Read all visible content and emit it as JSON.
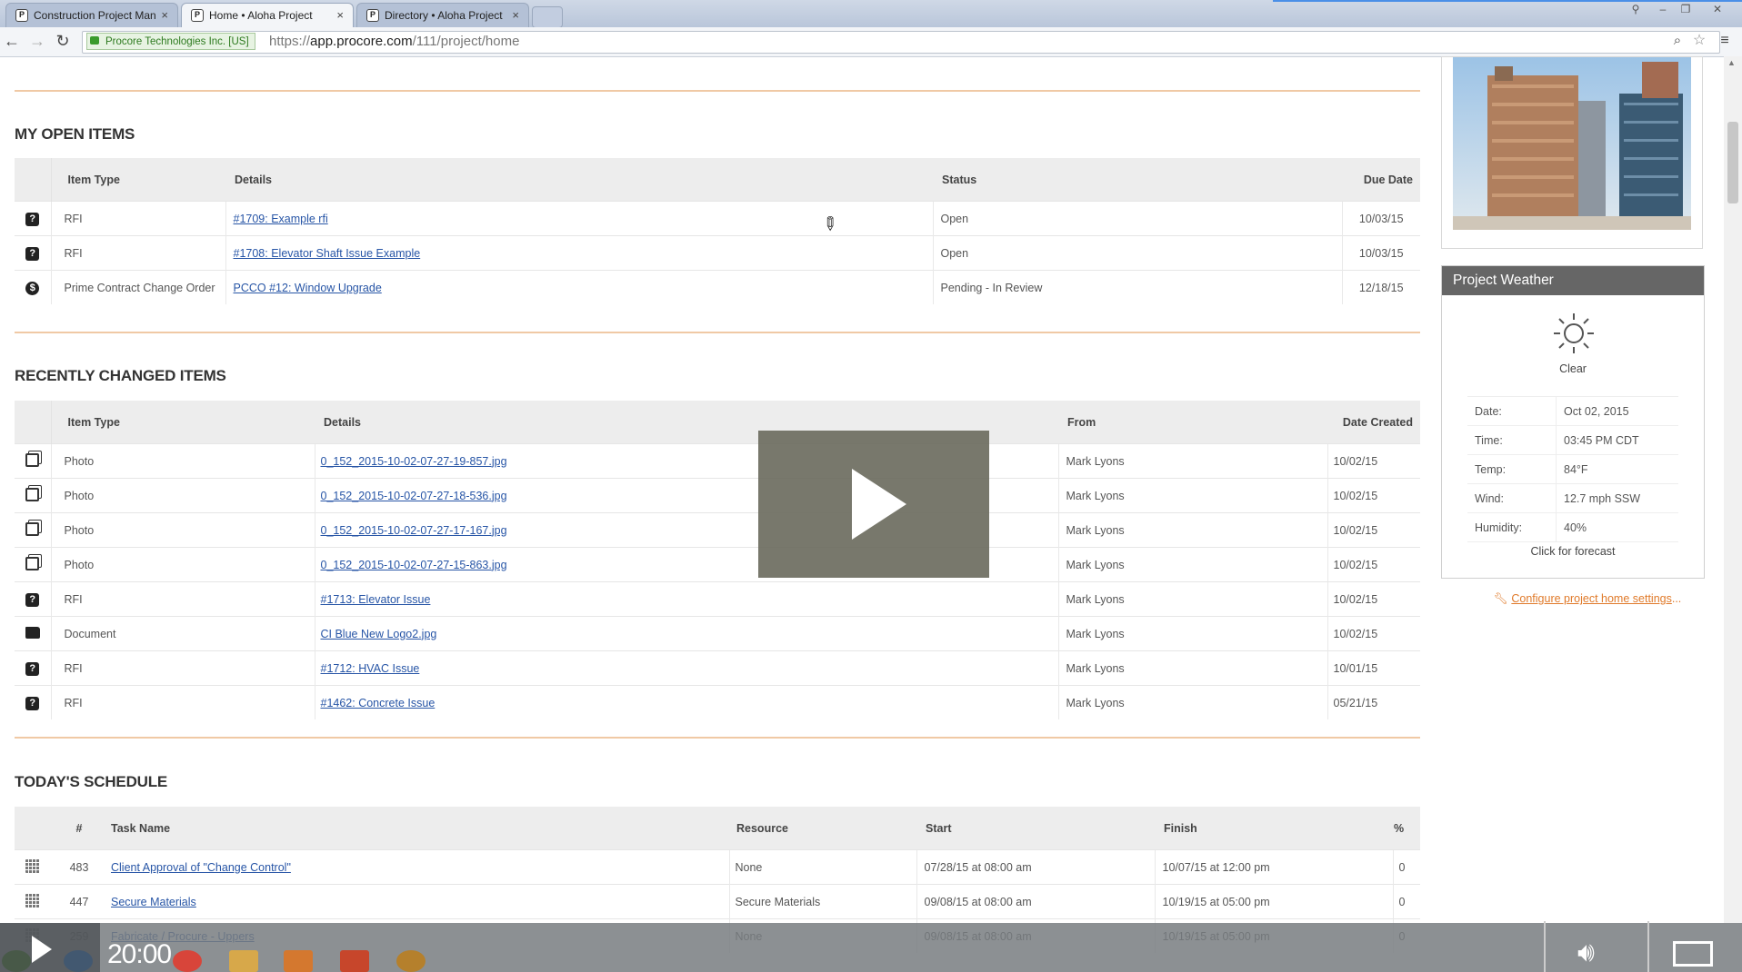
{
  "browser": {
    "tabs": [
      {
        "label": "Construction Project Man"
      },
      {
        "label": "Home • Aloha Project"
      },
      {
        "label": "Directory • Aloha Project"
      }
    ],
    "ssl_label": "Procore Technologies Inc. [US]",
    "url_prefix": "https://",
    "url_host": "app.procore.com",
    "url_path": "/111/project/home"
  },
  "open_items": {
    "title": "MY OPEN ITEMS",
    "headers": [
      "Item Type",
      "Details",
      "Status",
      "Due Date"
    ],
    "rows": [
      {
        "icon": "rfi-icon",
        "type": "RFI",
        "details": "#1709: Example rfi",
        "status": "Open",
        "due": "10/03/15"
      },
      {
        "icon": "rfi-icon",
        "type": "RFI",
        "details": "#1708: Elevator Shaft Issue Example",
        "status": "Open",
        "due": "10/03/15"
      },
      {
        "icon": "change-order-icon",
        "type": "Prime Contract Change Order",
        "details": "PCCO #12: Window Upgrade",
        "status": "Pending - In Review",
        "due": "12/18/15"
      }
    ]
  },
  "recent_items": {
    "title": "RECENTLY CHANGED ITEMS",
    "headers": [
      "Item Type",
      "Details",
      "From",
      "Date Created"
    ],
    "rows": [
      {
        "icon": "photo-icon",
        "type": "Photo",
        "details": "0_152_2015-10-02-07-27-19-857.jpg",
        "from": "Mark Lyons",
        "date": "10/02/15"
      },
      {
        "icon": "photo-icon",
        "type": "Photo",
        "details": "0_152_2015-10-02-07-27-18-536.jpg",
        "from": "Mark Lyons",
        "date": "10/02/15"
      },
      {
        "icon": "photo-icon",
        "type": "Photo",
        "details": "0_152_2015-10-02-07-27-17-167.jpg",
        "from": "Mark Lyons",
        "date": "10/02/15"
      },
      {
        "icon": "photo-icon",
        "type": "Photo",
        "details": "0_152_2015-10-02-07-27-15-863.jpg",
        "from": "Mark Lyons",
        "date": "10/02/15"
      },
      {
        "icon": "rfi-icon",
        "type": "RFI",
        "details": "#1713: Elevator Issue",
        "from": "Mark Lyons",
        "date": "10/02/15"
      },
      {
        "icon": "folder-icon",
        "type": "Document",
        "details": "CI Blue New Logo2.jpg",
        "from": "Mark Lyons",
        "date": "10/02/15"
      },
      {
        "icon": "rfi-icon",
        "type": "RFI",
        "details": "#1712: HVAC Issue",
        "from": "Mark Lyons",
        "date": "10/01/15"
      },
      {
        "icon": "rfi-icon",
        "type": "RFI",
        "details": "#1462: Concrete Issue",
        "from": "Mark Lyons",
        "date": "05/21/15"
      }
    ]
  },
  "schedule": {
    "title": "TODAY'S SCHEDULE",
    "headers": [
      "#",
      "Task Name",
      "Resource",
      "Start",
      "Finish",
      "%"
    ],
    "rows": [
      {
        "num": "483",
        "task": "Client Approval of \"Change Control\"",
        "resource": "None",
        "start": "07/28/15 at 08:00 am",
        "finish": "10/07/15 at 12:00 pm",
        "pct": "0"
      },
      {
        "num": "447",
        "task": "Secure Materials",
        "resource": "Secure Materials",
        "start": "09/08/15 at 08:00 am",
        "finish": "10/19/15 at 05:00 pm",
        "pct": "0"
      },
      {
        "num": "259",
        "task": "Fabricate / Procure - Uppers",
        "resource": "None",
        "start": "09/08/15 at 08:00 am",
        "finish": "10/19/15 at 05:00 pm",
        "pct": "0"
      }
    ]
  },
  "weather": {
    "title": "Project Weather",
    "condition": "Clear",
    "rows": [
      {
        "label": "Date:",
        "value": "Oct 02, 2015"
      },
      {
        "label": "Time:",
        "value": "03:45 PM CDT"
      },
      {
        "label": "Temp:",
        "value": "84°F"
      },
      {
        "label": "Wind:",
        "value": "12.7 mph SSW"
      },
      {
        "label": "Humidity:",
        "value": "40%"
      }
    ],
    "forecast_link": "Click for forecast"
  },
  "settings_link": "Configure project home settings",
  "video": {
    "time": "20:00"
  }
}
